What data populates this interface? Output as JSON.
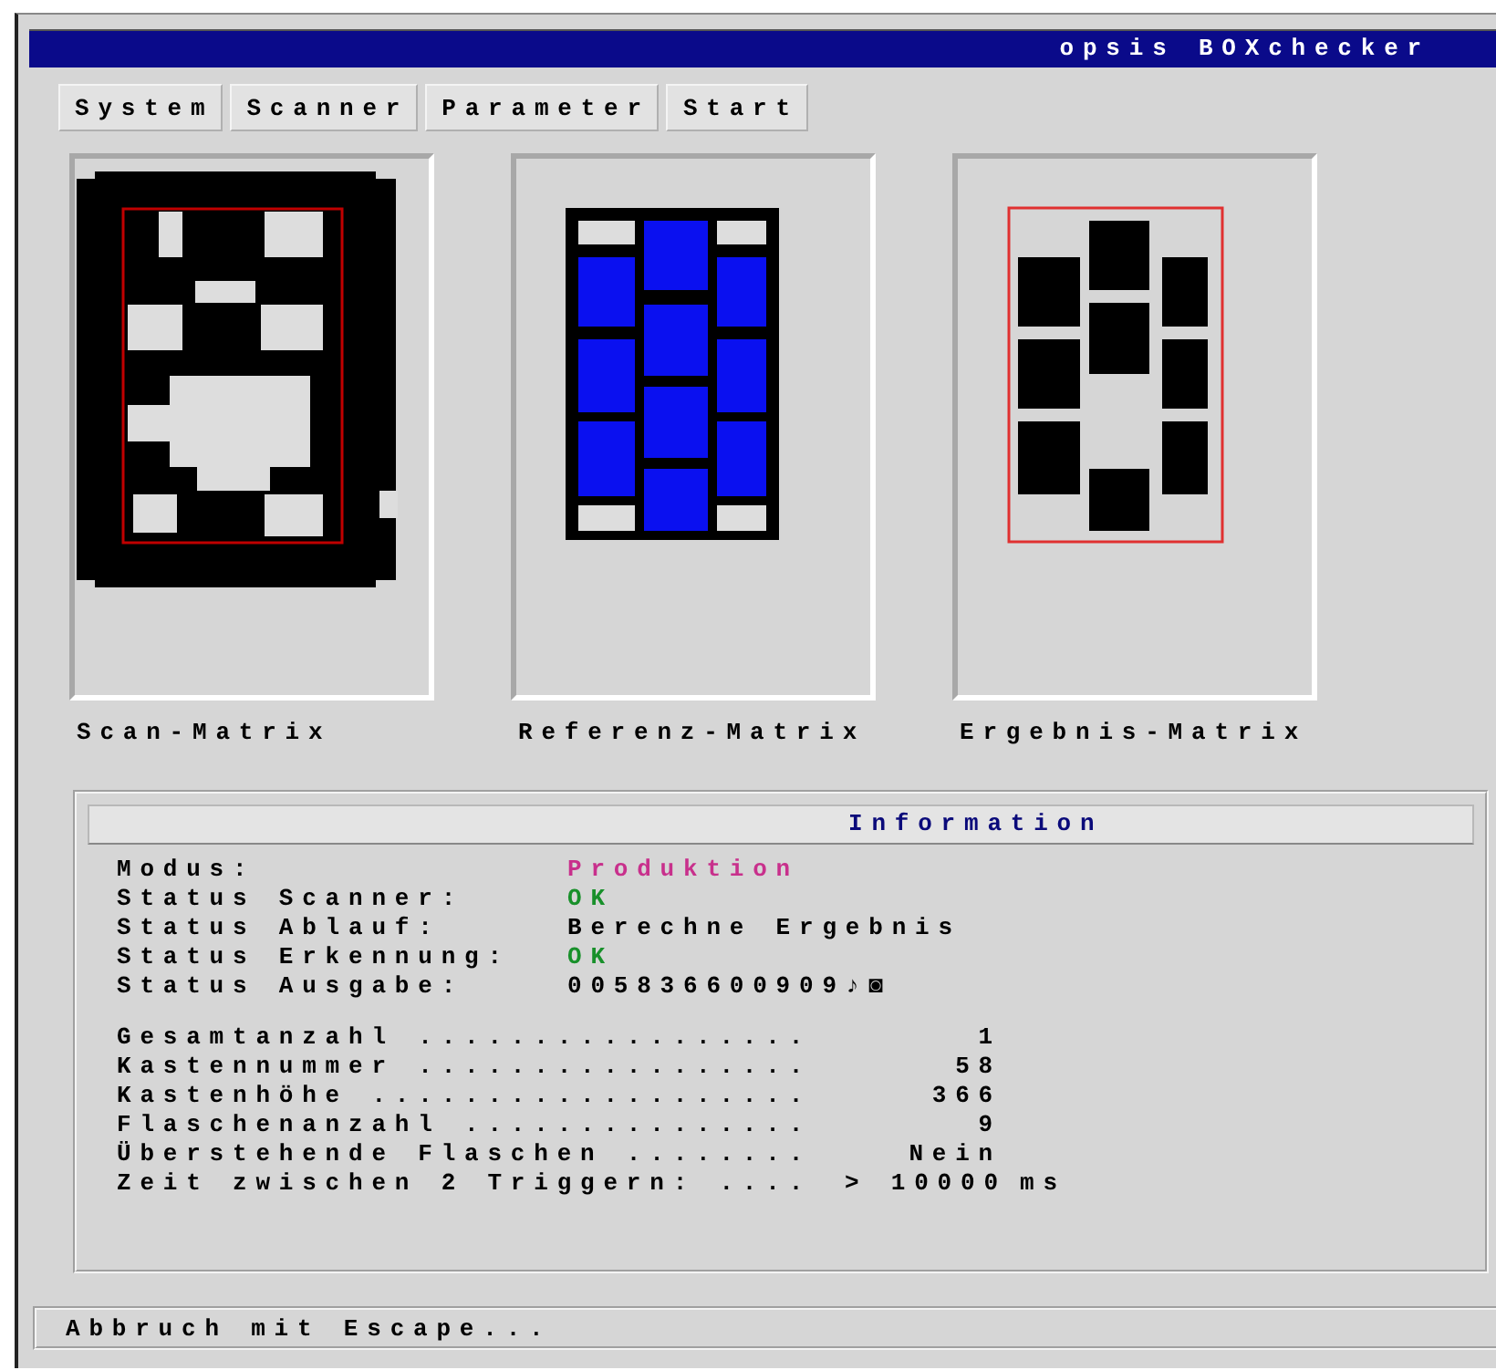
{
  "window": {
    "title": "opsis BOXchecker"
  },
  "menu": [
    {
      "label": "System"
    },
    {
      "label": "Scanner"
    },
    {
      "label": "Parameter"
    },
    {
      "label": "Start"
    }
  ],
  "matrices": [
    {
      "label": "Scan-Matrix",
      "kind": "scan"
    },
    {
      "label": "Referenz-Matrix",
      "kind": "reference"
    },
    {
      "label": "Ergebnis-Matrix",
      "kind": "result"
    }
  ],
  "information": {
    "title": "Information",
    "status": [
      {
        "label": "Modus:",
        "value": "Produktion",
        "color": "#c8308c"
      },
      {
        "label": "Status Scanner:",
        "value": "OK",
        "color": "#18902a"
      },
      {
        "label": "Status Ablauf:",
        "value": "Berechne Ergebnis",
        "color": "#000000"
      },
      {
        "label": "Status Erkennung:",
        "value": "OK",
        "color": "#18902a"
      },
      {
        "label": "Status Ausgabe:",
        "value": "005836600909♪◙",
        "color": "#000000"
      }
    ],
    "counters": [
      {
        "label": "Gesamtanzahl .................",
        "value": "1"
      },
      {
        "label": "Kastennummer .................",
        "value": "58"
      },
      {
        "label": "Kastenhöhe ...................",
        "value": "366"
      },
      {
        "label": "Flaschenanzahl ...............",
        "value": "9"
      },
      {
        "label": "Überstehende Flaschen ........",
        "value": "Nein"
      },
      {
        "label": "Zeit zwischen 2 Triggern: ....",
        "value": "> 10000",
        "unit": "ms"
      }
    ]
  },
  "status_bar": {
    "text": "Abbruch mit Escape..."
  }
}
